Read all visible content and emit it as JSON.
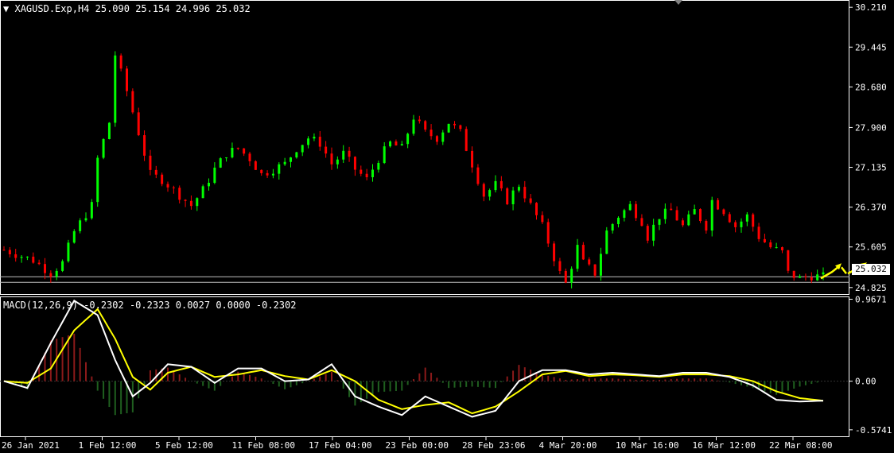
{
  "symbol_header": {
    "dropdown_glyph": "▼",
    "symbol": "XAGUSD.Exp,H4",
    "ohlc": "25.090 25.154 24.996 25.032"
  },
  "macd_header": {
    "label": "MACD(12,26,9)",
    "values": "-0.2302 -0.2323 0.0027 0.0000 -0.2302"
  },
  "current_price": "25.032",
  "colors": {
    "background": "#000000",
    "bull": "#00ff00",
    "bear": "#ff0000",
    "macd_line": "#ffffff",
    "signal_line": "#ffff00",
    "hist_pos": "#8b1a1a",
    "hist_neg": "#1f5f1f",
    "axis": "#ffffff"
  },
  "chart_data": [
    {
      "type": "candlestick",
      "title": "XAGUSD.Exp,H4",
      "ylim": [
        24.7,
        30.35
      ],
      "y_ticks": [
        "30.210",
        "29.445",
        "28.680",
        "27.900",
        "27.135",
        "26.370",
        "25.605",
        "24.825"
      ],
      "current_price": 25.032,
      "x_ticks": [
        "26 Jan 2021",
        "1 Feb 12:00",
        "5 Feb 12:00",
        "11 Feb 08:00",
        "17 Feb 04:00",
        "23 Feb 00:00",
        "28 Feb 23:06",
        "4 Mar 20:00",
        "10 Mar 16:00",
        "16 Mar 12:00",
        "22 Mar 08:00"
      ],
      "close_path": [
        [
          0,
          25.55
        ],
        [
          5,
          25.35
        ],
        [
          8,
          25.1
        ],
        [
          10,
          25.3
        ],
        [
          12,
          25.9
        ],
        [
          15,
          26.4
        ],
        [
          16,
          27.3
        ],
        [
          18,
          28.0
        ],
        [
          19,
          29.3
        ],
        [
          21,
          28.6
        ],
        [
          23,
          27.8
        ],
        [
          25,
          27.0
        ],
        [
          27,
          26.9
        ],
        [
          30,
          26.6
        ],
        [
          32,
          26.4
        ],
        [
          34,
          26.7
        ],
        [
          36,
          27.1
        ],
        [
          38,
          27.4
        ],
        [
          40,
          27.5
        ],
        [
          42,
          27.3
        ],
        [
          44,
          27.0
        ],
        [
          46,
          27.1
        ],
        [
          48,
          27.2
        ],
        [
          50,
          27.5
        ],
        [
          52,
          27.7
        ],
        [
          54,
          27.6
        ],
        [
          56,
          27.2
        ],
        [
          58,
          27.4
        ],
        [
          60,
          27.1
        ],
        [
          62,
          26.9
        ],
        [
          64,
          27.3
        ],
        [
          66,
          27.6
        ],
        [
          68,
          27.5
        ],
        [
          70,
          28.1
        ],
        [
          72,
          27.8
        ],
        [
          74,
          27.7
        ],
        [
          76,
          28.0
        ],
        [
          78,
          27.8
        ],
        [
          80,
          27.2
        ],
        [
          82,
          26.6
        ],
        [
          84,
          26.8
        ],
        [
          86,
          26.5
        ],
        [
          88,
          26.8
        ],
        [
          90,
          26.4
        ],
        [
          92,
          26.0
        ],
        [
          94,
          25.4
        ],
        [
          95,
          25.1
        ],
        [
          96,
          24.9
        ],
        [
          98,
          25.6
        ],
        [
          99,
          25.3
        ],
        [
          101,
          25.1
        ],
        [
          103,
          25.9
        ],
        [
          105,
          26.2
        ],
        [
          107,
          26.4
        ],
        [
          109,
          26.1
        ],
        [
          110,
          25.8
        ],
        [
          112,
          26.2
        ],
        [
          114,
          26.3
        ],
        [
          116,
          26.0
        ],
        [
          118,
          26.3
        ],
        [
          120,
          26.0
        ],
        [
          121,
          26.5
        ],
        [
          123,
          26.3
        ],
        [
          125,
          26.0
        ],
        [
          127,
          26.2
        ],
        [
          129,
          25.8
        ],
        [
          131,
          25.6
        ],
        [
          133,
          25.5
        ],
        [
          134,
          25.1
        ],
        [
          136,
          25.0
        ],
        [
          138,
          25.05
        ],
        [
          140,
          25.032
        ]
      ],
      "forecast_arrows": "yellow"
    },
    {
      "type": "line",
      "title": "MACD(12,26,9)",
      "ylim": [
        -0.66,
        1.0
      ],
      "y_ticks": [
        "0.9671",
        "0.00",
        "-0.5741"
      ],
      "series": [
        {
          "name": "MACD",
          "x": [
            0,
            4,
            8,
            12,
            16,
            19,
            22,
            25,
            28,
            32,
            36,
            40,
            44,
            48,
            52,
            56,
            60,
            64,
            68,
            72,
            76,
            80,
            84,
            88,
            92,
            96,
            100,
            104,
            108,
            112,
            116,
            120,
            124,
            128,
            132,
            136,
            140
          ],
          "values": [
            0.0,
            -0.08,
            0.45,
            0.95,
            0.78,
            0.25,
            -0.18,
            -0.02,
            0.2,
            0.17,
            -0.02,
            0.15,
            0.15,
            0.0,
            0.02,
            0.2,
            -0.18,
            -0.3,
            -0.4,
            -0.18,
            -0.3,
            -0.42,
            -0.35,
            0.0,
            0.13,
            0.13,
            0.08,
            0.1,
            0.08,
            0.06,
            0.1,
            0.1,
            0.05,
            -0.05,
            -0.22,
            -0.24,
            -0.23
          ]
        },
        {
          "name": "Signal",
          "x": [
            0,
            4,
            8,
            12,
            16,
            19,
            22,
            25,
            28,
            32,
            36,
            40,
            44,
            48,
            52,
            56,
            60,
            64,
            68,
            72,
            76,
            80,
            84,
            88,
            92,
            96,
            100,
            104,
            108,
            112,
            116,
            120,
            124,
            128,
            132,
            136,
            140
          ],
          "values": [
            0.0,
            -0.02,
            0.15,
            0.6,
            0.85,
            0.5,
            0.05,
            -0.1,
            0.1,
            0.17,
            0.05,
            0.08,
            0.13,
            0.06,
            0.02,
            0.13,
            0.0,
            -0.22,
            -0.33,
            -0.28,
            -0.25,
            -0.38,
            -0.3,
            -0.12,
            0.08,
            0.12,
            0.06,
            0.08,
            0.07,
            0.05,
            0.08,
            0.08,
            0.06,
            0.0,
            -0.12,
            -0.2,
            -0.23
          ]
        }
      ]
    }
  ]
}
